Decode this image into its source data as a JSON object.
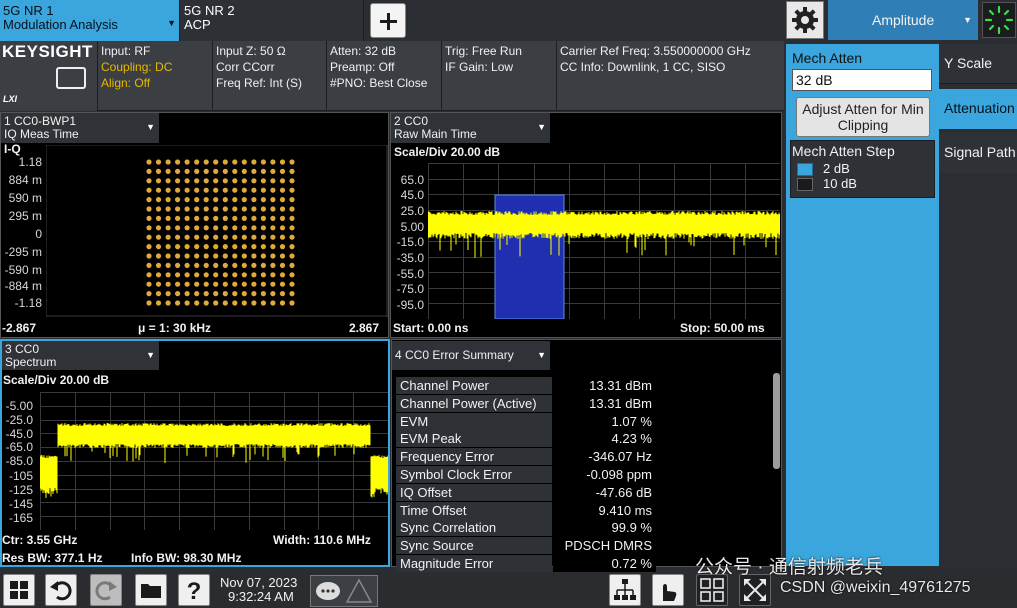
{
  "tabs": [
    {
      "line1": "5G NR 1",
      "line2": "Modulation Analysis"
    },
    {
      "line1": "5G NR 2",
      "line2": "ACP"
    }
  ],
  "menu": {
    "title": "Amplitude"
  },
  "info": {
    "logo": "KEYSIGHT",
    "lxi": "LXI",
    "col1": [
      "Input: RF",
      "Coupling: DC",
      "Align: Off"
    ],
    "col2": [
      "Input Z: 50 Ω",
      "Corr CCorr",
      "Freq Ref: Int (S)"
    ],
    "col3": [
      "Atten: 32 dB",
      "Preamp: Off",
      "#PNO: Best Close"
    ],
    "col4": [
      "Trig: Free Run",
      "IF Gain: Low"
    ],
    "col5": [
      "Carrier Ref Freq: 3.550000000 GHz",
      "CC Info: Downlink, 1 CC, SISO"
    ]
  },
  "right_panel": {
    "mech_atten_label": "Mech Atten",
    "mech_atten_value": "32 dB",
    "adjust_button": [
      "Adjust Atten for Min",
      "Clipping"
    ],
    "step_label": "Mech Atten Step",
    "step_options": [
      "2 dB",
      "10 dB"
    ],
    "step_selected": "2 dB",
    "side_tabs": [
      "Y Scale",
      "Attenuation",
      "Signal Path"
    ],
    "side_active": "Attenuation"
  },
  "panels": {
    "iq": {
      "title": [
        "1 CC0-BWP1",
        "IQ Meas Time"
      ],
      "corner": "I-Q",
      "y_ticks": [
        "1.18",
        "884 m",
        "590 m",
        "295 m",
        "0",
        "-295 m",
        "-590 m",
        "-884 m",
        "-1.18"
      ],
      "x_left": "-2.867",
      "x_center": "μ = 1: 30 kHz",
      "x_right": "2.867"
    },
    "raw": {
      "title": [
        "2 CC0",
        "Raw Main Time"
      ],
      "scale": "Scale/Div 20.00 dB",
      "y_ticks": [
        "65.0",
        "45.0",
        "25.0",
        "5.00",
        "-15.0",
        "-35.0",
        "-55.0",
        "-75.0",
        "-95.0"
      ],
      "start": "Start: 0.00 ns",
      "stop": "Stop: 50.00 ms"
    },
    "spectrum": {
      "title": [
        "3 CC0",
        "Spectrum"
      ],
      "scale": "Scale/Div 20.00 dB",
      "y_ticks": [
        "-5.00",
        "-25.0",
        "-45.0",
        "-65.0",
        "-85.0",
        "-105",
        "-125",
        "-145",
        "-165"
      ],
      "ctr": "Ctr: 3.55 GHz",
      "res_bw": "Res BW: 377.1 Hz",
      "info_bw": "Info BW: 98.30 MHz",
      "width": "Width: 110.6 MHz"
    },
    "errors": {
      "title": "4 CC0 Error Summary",
      "rows": [
        {
          "name": "Channel Power",
          "value": "13.31 dBm"
        },
        {
          "name": "Channel Power (Active)",
          "value": "13.31 dBm"
        },
        {
          "name": "EVM",
          "value": "1.07 %"
        },
        {
          "name": "EVM Peak",
          "value": "4.23 %"
        },
        {
          "name": "Frequency Error",
          "value": "-346.07 Hz"
        },
        {
          "name": "Symbol Clock Error",
          "value": "-0.098 ppm"
        },
        {
          "name": "IQ Offset",
          "value": "-47.66 dB"
        },
        {
          "name": "Time Offset",
          "value": "9.410 ms"
        },
        {
          "name": "Sync Correlation",
          "value": "99.9 %"
        },
        {
          "name": "Sync Source",
          "value": "PDSCH DMRS"
        },
        {
          "name": "Magnitude Error",
          "value": "0.72 %"
        }
      ]
    }
  },
  "status": {
    "date": "Nov 07, 2023",
    "time": "9:32:24 AM"
  },
  "watermarks": {
    "wechat": "公众号 · 通信射频老兵",
    "csdn": "CSDN @weixin_49761275"
  },
  "colors": {
    "accent": "#3aa6dd",
    "trace": "#ffff00",
    "constellation": "#e0a93a",
    "gate": "#1f2fb0"
  }
}
